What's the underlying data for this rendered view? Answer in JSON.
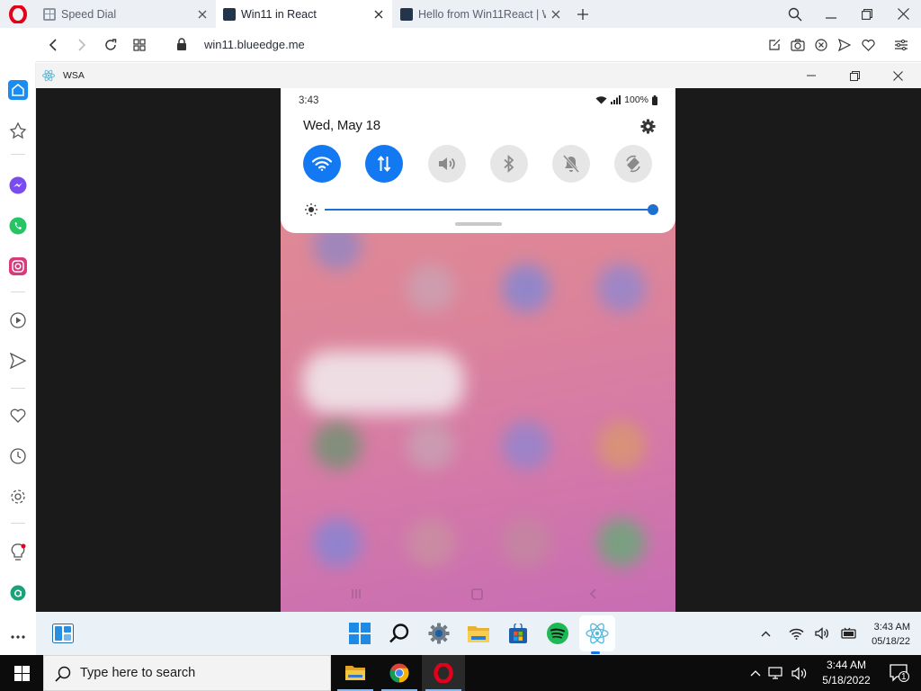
{
  "browser": {
    "tabs": [
      {
        "title": "Speed Dial",
        "active": false
      },
      {
        "title": "Win11 in React",
        "active": true
      },
      {
        "title": "Hello from Win11React | W",
        "active": false
      }
    ],
    "url": "win11.blueedge.me"
  },
  "wsa": {
    "title": "WSA"
  },
  "android": {
    "time": "3:43",
    "battery": "100%",
    "date": "Wed, May 18",
    "quick_toggles": [
      {
        "name": "wifi",
        "on": true
      },
      {
        "name": "mobile-data",
        "on": true
      },
      {
        "name": "sound",
        "on": false
      },
      {
        "name": "bluetooth",
        "on": false
      },
      {
        "name": "do-not-disturb",
        "on": false
      },
      {
        "name": "auto-rotate",
        "on": false
      }
    ],
    "brightness": 1.0
  },
  "win11_taskbar": {
    "time": "3:43 AM",
    "date": "05/18/22"
  },
  "win10_taskbar": {
    "search_placeholder": "Type here to search",
    "time": "3:44 AM",
    "date": "5/18/2022",
    "notification_count": "1"
  },
  "colors": {
    "accent_blue": "#1279f2",
    "opera_red": "#e2001a"
  }
}
